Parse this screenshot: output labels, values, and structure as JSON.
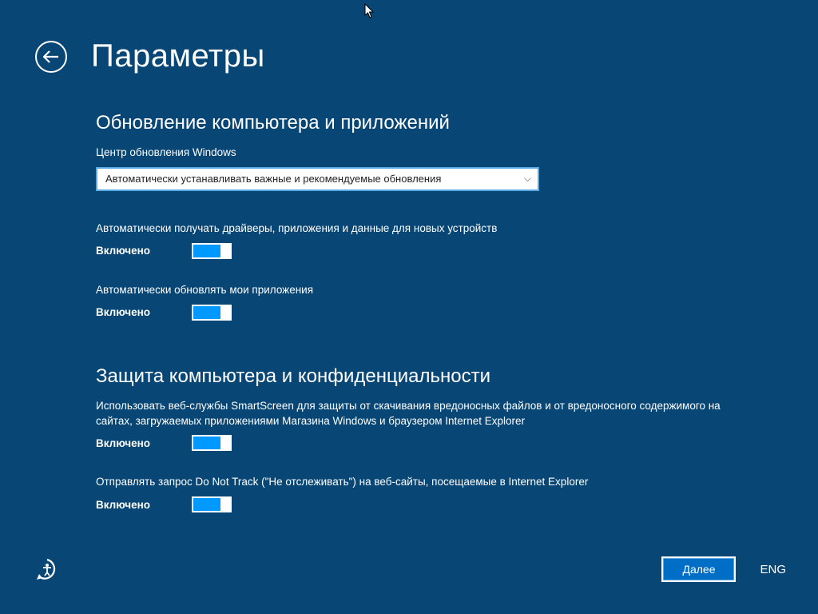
{
  "header": {
    "title": "Параметры"
  },
  "section_updates": {
    "heading": "Обновление компьютера и приложений",
    "wu_label": "Центр обновления Windows",
    "wu_selected": "Автоматически устанавливать важные и рекомендуемые обновления",
    "drivers_desc": "Автоматически получать драйверы, приложения и данные для новых устройств",
    "drivers_state": "Включено",
    "apps_desc": "Автоматически обновлять мои приложения",
    "apps_state": "Включено"
  },
  "section_privacy": {
    "heading": "Защита компьютера и конфиденциальности",
    "smartscreen_desc": "Использовать веб-службы SmartScreen для защиты от скачивания вредоносных файлов и от вредоносного содержимого на сайтах, загружаемых приложениями Магазина Windows и браузером Internet Explorer",
    "smartscreen_state": "Включено",
    "dnt_desc": "Отправлять запрос Do Not Track (\"Не отслеживать\") на веб-сайты, посещаемые в Internet Explorer",
    "dnt_state": "Включено"
  },
  "footer": {
    "next": "Далее",
    "lang": "ENG"
  }
}
